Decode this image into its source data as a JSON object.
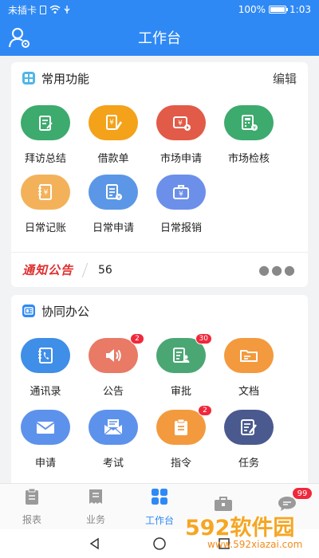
{
  "status_bar": {
    "carrier": "未插卡",
    "battery": "100%",
    "battery_level": 1.0,
    "time": "1:03"
  },
  "header": {
    "title": "工作台"
  },
  "common": {
    "title": "常用功能",
    "edit_label": "编辑",
    "items": [
      {
        "label": "拜访总结",
        "color": "#3daa6e",
        "icon": "clipboard-edit-icon"
      },
      {
        "label": "借款单",
        "color": "#f3a21a",
        "icon": "yen-pencil-icon"
      },
      {
        "label": "市场申请",
        "color": "#e25a48",
        "icon": "yen-video-icon"
      },
      {
        "label": "市场检核",
        "color": "#3daa6e",
        "icon": "calculator-yen-icon"
      },
      {
        "label": "日常记账",
        "color": "#f3b25a",
        "icon": "yen-notebook-icon"
      },
      {
        "label": "日常申请",
        "color": "#5b97e6",
        "icon": "doc-yen-icon"
      },
      {
        "label": "日常报销",
        "color": "#6c8fea",
        "icon": "yen-briefcase-icon"
      }
    ]
  },
  "notice": {
    "logo_text": "通知公告",
    "count": "56"
  },
  "collab": {
    "title": "协同办公",
    "items": [
      {
        "label": "通讯录",
        "color": "#3f8ee8",
        "icon": "phone-book-icon",
        "badge": ""
      },
      {
        "label": "公告",
        "color": "#e87a66",
        "icon": "speaker-icon",
        "badge": "2"
      },
      {
        "label": "审批",
        "color": "#4aa774",
        "icon": "approval-icon",
        "badge": "30"
      },
      {
        "label": "文档",
        "color": "#f39a3e",
        "icon": "folder-icon",
        "badge": ""
      },
      {
        "label": "申请",
        "color": "#5d92ec",
        "icon": "mail-icon",
        "badge": ""
      },
      {
        "label": "考试",
        "color": "#5d92ec",
        "icon": "exam-mail-icon",
        "badge": ""
      },
      {
        "label": "指令",
        "color": "#f39a3e",
        "icon": "clipboard-icon",
        "badge": "2"
      },
      {
        "label": "任务",
        "color": "#4a5a8e",
        "icon": "task-edit-icon",
        "badge": ""
      }
    ]
  },
  "tabbar": {
    "tabs": [
      {
        "label": "报表",
        "icon": "report-icon",
        "active": false
      },
      {
        "label": "业务",
        "icon": "business-icon",
        "active": false
      },
      {
        "label": "工作台",
        "icon": "workbench-icon",
        "active": true
      },
      {
        "label": "",
        "icon": "briefcase-icon",
        "active": false
      },
      {
        "label": "",
        "icon": "message-icon",
        "active": false,
        "badge": "99"
      }
    ]
  },
  "watermark": {
    "main": "592软件园",
    "sub": "www.592xiazai.com"
  },
  "colors": {
    "primary": "#2f89f5",
    "badge": "#f0283c"
  }
}
